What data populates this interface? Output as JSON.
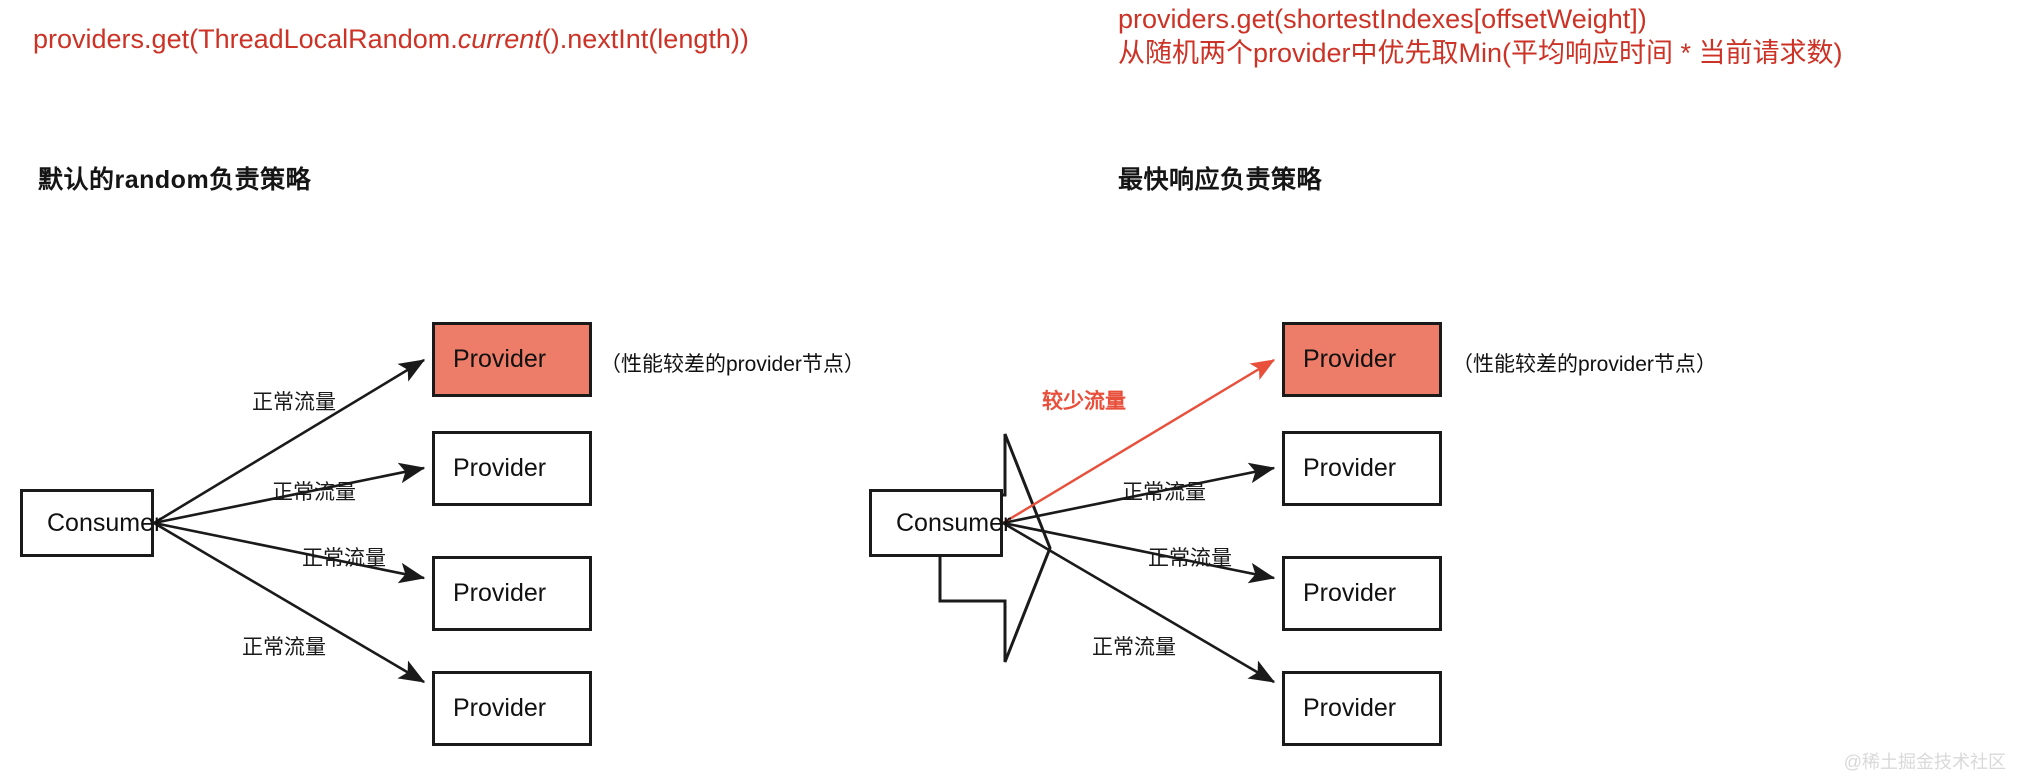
{
  "captions": {
    "left": {
      "part1": "providers.get(ThreadLocalRandom.",
      "italic": "current",
      "part2": "().nextInt(length))"
    },
    "right": {
      "line1": "providers.get(shortestIndexes[offsetWeight])",
      "line2": "从随机两个provider中优先取Min(平均响应时间 * 当前请求数)"
    }
  },
  "headings": {
    "left": "默认的random负责策略",
    "right": "最快响应负责策略"
  },
  "left_diagram": {
    "consumer": "Consumer",
    "providers": [
      {
        "label": "Provider",
        "highlighted": true
      },
      {
        "label": "Provider",
        "highlighted": false
      },
      {
        "label": "Provider",
        "highlighted": false
      },
      {
        "label": "Provider",
        "highlighted": false
      }
    ],
    "edge_labels": [
      "正常流量",
      "正常流量",
      "正常流量",
      "正常流量"
    ],
    "note": "（性能较差的provider节点）"
  },
  "right_diagram": {
    "consumer": "Consumer",
    "providers": [
      {
        "label": "Provider",
        "highlighted": true
      },
      {
        "label": "Provider",
        "highlighted": false
      },
      {
        "label": "Provider",
        "highlighted": false
      },
      {
        "label": "Provider",
        "highlighted": false
      }
    ],
    "edge_labels": [
      "较少流量",
      "正常流量",
      "正常流量",
      "正常流量"
    ],
    "note": "（性能较差的provider节点）"
  },
  "transition_arrow": "right-block-arrow",
  "watermark": "@稀土掘金技术社区",
  "colors": {
    "code_red": "#CC3326",
    "node_fill_red": "#ED7D68",
    "edge_red": "#E8503C",
    "stroke": "#1a1a1a",
    "background": "#ffffff"
  }
}
